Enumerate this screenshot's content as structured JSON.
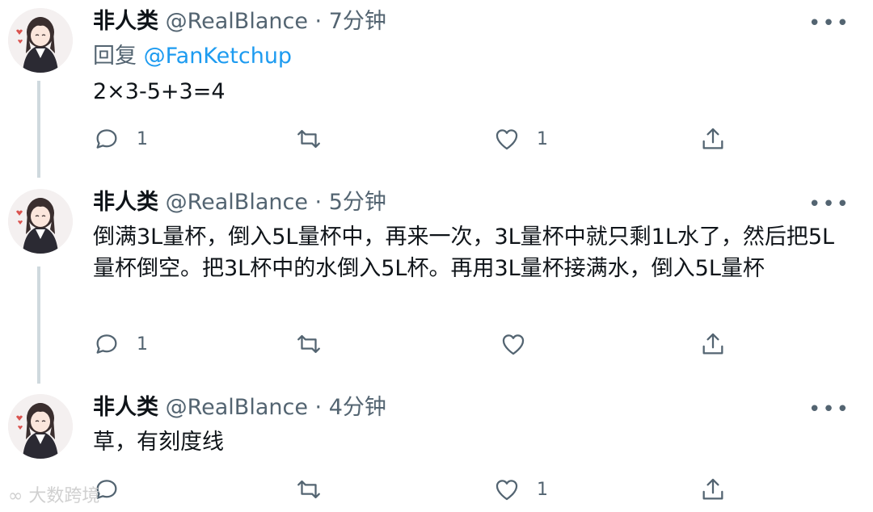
{
  "tweets": [
    {
      "name": "非人类",
      "handle": "@RealBlance",
      "time": "7分钟",
      "reply_prefix": "回复",
      "reply_mention": "@FanKetchup",
      "text": "2×3-5+3=4",
      "reply_count": "1",
      "retweet_count": "",
      "like_count": "1"
    },
    {
      "name": "非人类",
      "handle": "@RealBlance",
      "time": "5分钟",
      "text": "倒满3L量杯，倒入5L量杯中，再来一次，3L量杯中就只剩1L水了，然后把5L量杯倒空。把3L杯中的水倒入5L杯。再用3L量杯接满水，倒入5L量杯",
      "reply_count": "1",
      "retweet_count": "",
      "like_count": ""
    },
    {
      "name": "非人类",
      "handle": "@RealBlance",
      "time": "4分钟",
      "text": "草，有刻度线",
      "reply_count": "",
      "retweet_count": "",
      "like_count": "1"
    }
  ],
  "separator": "·",
  "more_label": "•••",
  "watermark": "大数跨境"
}
